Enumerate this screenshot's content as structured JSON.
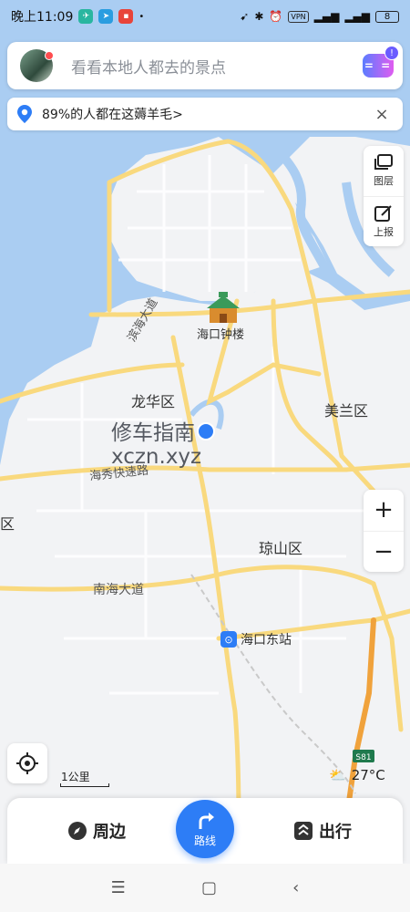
{
  "status_bar": {
    "time": "晚上11:09",
    "vpn": "VPN",
    "battery": "8"
  },
  "search": {
    "placeholder": "看看本地人都去的景点"
  },
  "tip": {
    "text": "89%的人都在这薅羊毛>",
    "close": "×"
  },
  "tools": [
    {
      "label": "图层"
    },
    {
      "label": "上报"
    }
  ],
  "zoom": {
    "in": "+",
    "out": "−"
  },
  "map": {
    "landmark": "海口钟楼",
    "districts": [
      "龙华区",
      "美兰区",
      "琼山区",
      "区"
    ],
    "roads": [
      "滨海大道",
      "海秀快速路",
      "南海大道"
    ],
    "station": "海口东站",
    "highway": "S81",
    "watermark_line1": "修车指南",
    "watermark_line2": "xczn.xyz"
  },
  "scale": "1公里",
  "weather": {
    "temp": "27°C"
  },
  "bottom_nav": {
    "nearby": "周边",
    "route": "路线",
    "travel": "出行"
  },
  "colors": {
    "water": "#a9d0f5",
    "land": "#f2f3f5",
    "road": "#f9d97e",
    "highway": "#f0a23c",
    "accent": "#2d7df6"
  }
}
